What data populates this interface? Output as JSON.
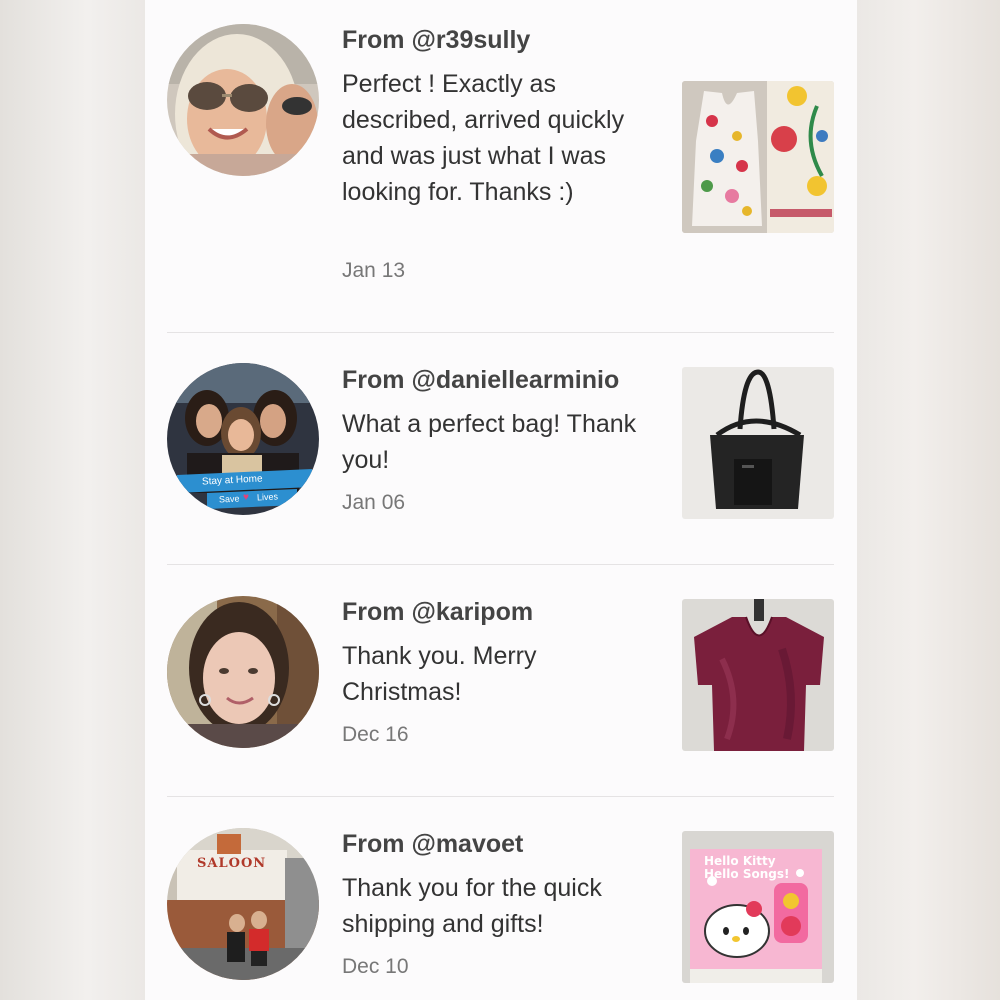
{
  "reviews": [
    {
      "from": "From @r39sully",
      "message": "Perfect ! Exactly as described, arrived quickly and was just what I was looking for. Thanks :)",
      "date": "Jan 13"
    },
    {
      "from": "From @daniellearminio",
      "message": "What a perfect bag! Thank you!",
      "date": "Jan 06",
      "avatar_banner": [
        "Stay at Home",
        "Save",
        "Lives"
      ]
    },
    {
      "from": "From @karipom",
      "message": "Thank you. Merry Christmas!",
      "date": "Dec 16"
    },
    {
      "from": "From @mavoet",
      "message": "Thank you for the quick shipping and gifts!",
      "date": "Dec 10",
      "avatar_sign": "SALOON",
      "product_title": "Hello Kitty Hello Songs!"
    }
  ],
  "colors": {
    "panel": "#fcfbfc",
    "heading_text": "#444444",
    "body_text": "#333333",
    "date_text": "#777777",
    "divider": "#e5e3e4"
  }
}
